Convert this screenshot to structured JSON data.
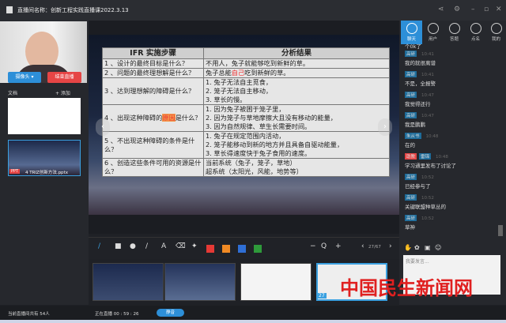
{
  "window": {
    "title": "直播间名称：创新工程实践直播课2022.3.13"
  },
  "left": {
    "camera_button": "摄像头 ▾",
    "end_live_button": "结束直播",
    "docs_label": "文档",
    "add_label": "+ 添加",
    "file_badge": "PPT",
    "file_name": "4 TRIZ创新方法.pptx"
  },
  "slide": {
    "headers": [
      "IFR 实施步骤",
      "分析结果"
    ],
    "rows": [
      {
        "q": "1 、设计的最终目标是什么？",
        "a": [
          "不用人，兔子就能够吃到新鲜的草。"
        ]
      },
      {
        "q": "2 、问题的最终理想解是什么？",
        "a_pre": "兔子总能",
        "a_hl": "自己",
        "a_post": "吃到新鲜的草。"
      },
      {
        "q": "3 、达到理想解的障碍是什么？",
        "a": [
          "1. 兔子无法自主觅食，",
          "2. 笼子无法自主移动，",
          "3. 草长的慢。"
        ]
      },
      {
        "q_pre": "4 、出现这种障碍的",
        "q_hl": "原因",
        "q_post": "是什么？",
        "a": [
          "1. 因为兔子被困于笼子里，",
          "2. 因为笼子与草地摩擦大且没有移动的能量，",
          "3. 因为自然规律、草生长需要时间。"
        ]
      },
      {
        "q": "5 、不出现这种障碍的条件是什么？",
        "a": [
          "1. 兔子在规定范围内活动，",
          "2. 笼子能移动到新的地方并且具备自驱动能量，",
          "3. 草长得速度快于兔子食用的速度。"
        ]
      },
      {
        "q": "6 、创造这些条件可用的资源是什么？",
        "a": [
          "当前系统（兔子，笼子，草地）",
          "超系统（太阳光，风能，地势等）"
        ]
      }
    ]
  },
  "toolbar": {
    "colors": [
      "#e53935",
      "#f08a24",
      "#2f6fd6",
      "#2e9a3a"
    ],
    "zoom_out": "−",
    "zoom_in": "+",
    "page": "27/67"
  },
  "thumbnails": {
    "current_label": "27"
  },
  "right": {
    "tabs": [
      "聊天",
      "用户",
      "答题",
      "点名",
      "我的"
    ],
    "first_msg": "个0k了",
    "messages": [
      {
        "name": "高研",
        "time": "10:41",
        "text": "我的就很离谱"
      },
      {
        "name": "高研",
        "time": "10:41",
        "text": "不是，全报警"
      },
      {
        "name": "高研",
        "time": "10:47",
        "text": "我觉得还行"
      },
      {
        "name": "高研",
        "time": "10:47",
        "text": "我是鹏鹏"
      },
      {
        "name": "朱从书",
        "time": "10:48",
        "text": "在的"
      },
      {
        "badge": "助教",
        "name": "雷锦",
        "time": "10:48",
        "text": "学习通里发布了讨论了"
      },
      {
        "name": "高研",
        "time": "10:52",
        "text": "已经参与了"
      },
      {
        "name": "高研",
        "time": "10:52",
        "text": "关键联盟种草丛的"
      },
      {
        "name": "高研",
        "time": "10:52",
        "text": "草神"
      }
    ],
    "input_placeholder": "我要发言..."
  },
  "status": {
    "online": "当前直播间共有 54人",
    "live_time": "正在直播 00 : 59 : 26",
    "mute_button": "静音"
  },
  "watermark": "中国民生新闻网"
}
